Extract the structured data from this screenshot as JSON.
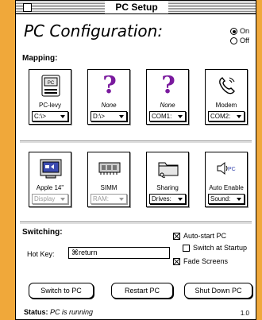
{
  "window": {
    "title": "PC Setup"
  },
  "header": {
    "title": "PC Configuration:",
    "power": {
      "on_label": "On",
      "off_label": "Off",
      "selected": "On"
    }
  },
  "mapping": {
    "label": "Mapping:",
    "slots": [
      {
        "label": "PC-levy",
        "label_style": "normal",
        "value": "C:\\>",
        "enabled": true,
        "icon": "pc-drive-icon"
      },
      {
        "label": "None",
        "label_style": "italic",
        "value": "D:\\>",
        "enabled": true,
        "icon": "question-mark-icon"
      },
      {
        "label": "None",
        "label_style": "italic",
        "value": "COM1:",
        "enabled": true,
        "icon": "question-mark-icon"
      },
      {
        "label": "Modem",
        "label_style": "normal",
        "value": "COM2:",
        "enabled": true,
        "icon": "telephone-icon"
      }
    ],
    "devices": [
      {
        "label": "Apple 14\"",
        "value": "Display",
        "enabled": false,
        "icon": "monitor-icon"
      },
      {
        "label": "SIMM",
        "value": "RAM:",
        "enabled": false,
        "icon": "memory-chip-icon"
      },
      {
        "label": "Sharing",
        "value": "Drives:",
        "enabled": true,
        "icon": "folder-icon"
      },
      {
        "label": "Auto Enable",
        "value": "Sound:",
        "enabled": true,
        "icon": "speaker-icon",
        "icon_text": "PC"
      }
    ]
  },
  "switching": {
    "label": "Switching:",
    "hotkey_label": "Hot Key:",
    "hotkey_value": "⌘return",
    "options": [
      {
        "label": "Auto-start PC",
        "checked": true
      },
      {
        "label": "Switch at Startup",
        "checked": false
      },
      {
        "label": "Fade Screens",
        "checked": true
      }
    ]
  },
  "buttons": {
    "switch": "Switch to PC",
    "restart": "Restart PC",
    "shutdown": "Shut Down PC"
  },
  "status": {
    "label": "Status:",
    "value": "PC is running"
  },
  "version": "1.0",
  "colors": {
    "background": "#f0a83a",
    "question_mark": "#7a1a9e",
    "speaker_accent": "#3c4bb0"
  }
}
